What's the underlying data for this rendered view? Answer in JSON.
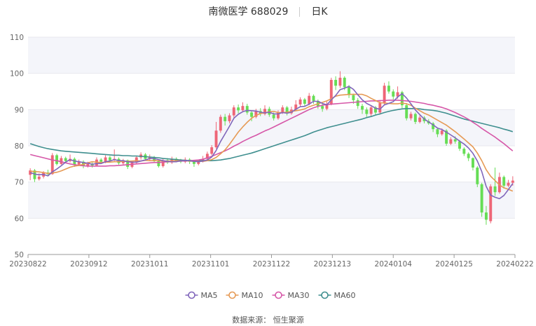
{
  "title": {
    "stock": "南微医学 688029",
    "period": "日K"
  },
  "source_text": "数据来源：  恒生聚源",
  "colors": {
    "up": "#ee6677",
    "down": "#66dd55",
    "ma5": "#8066bb",
    "ma10": "#e69a55",
    "ma30": "#d657a8",
    "ma60": "#3f8f8f",
    "band": "#f4f5fa",
    "grid": "#e8e8ee"
  },
  "chart_data": {
    "type": "candlestick",
    "ylim": [
      50,
      110
    ],
    "yticks": [
      50,
      60,
      70,
      80,
      90,
      100,
      110
    ],
    "xtick_labels": [
      "20230822",
      "20230912",
      "20231011",
      "20231101",
      "20231122",
      "20231213",
      "20240104",
      "20240125",
      "20240222"
    ],
    "legend": [
      "MA5",
      "MA10",
      "MA30",
      "MA60"
    ],
    "legend_position": "bottom",
    "candles": [
      [
        72.0,
        73.2,
        73.8,
        70.5
      ],
      [
        73.2,
        70.8,
        73.6,
        70.0
      ],
      [
        70.8,
        71.5,
        72.4,
        70.4
      ],
      [
        71.5,
        72.6,
        73.0,
        71.0
      ],
      [
        72.6,
        72.2,
        73.4,
        71.6
      ],
      [
        72.2,
        77.4,
        78.0,
        72.0
      ],
      [
        77.4,
        75.0,
        77.8,
        74.6
      ],
      [
        75.0,
        76.6,
        77.2,
        74.8
      ],
      [
        76.6,
        75.8,
        77.0,
        75.2
      ],
      [
        75.8,
        76.4,
        77.6,
        75.4
      ],
      [
        76.4,
        74.8,
        76.8,
        74.2
      ],
      [
        74.8,
        75.6,
        76.2,
        74.4
      ],
      [
        75.6,
        74.4,
        76.0,
        73.8
      ],
      [
        74.4,
        75.0,
        75.6,
        74.0
      ],
      [
        75.0,
        74.6,
        75.4,
        74.0
      ],
      [
        74.6,
        76.2,
        76.8,
        74.4
      ],
      [
        76.2,
        75.6,
        76.6,
        75.0
      ],
      [
        75.6,
        76.8,
        77.4,
        75.2
      ],
      [
        76.8,
        76.0,
        77.2,
        75.6
      ],
      [
        76.0,
        76.4,
        79.0,
        75.8
      ],
      [
        76.4,
        75.2,
        76.8,
        74.8
      ],
      [
        75.2,
        76.0,
        76.4,
        74.6
      ],
      [
        76.0,
        74.2,
        76.2,
        73.6
      ],
      [
        74.2,
        75.4,
        75.8,
        73.8
      ],
      [
        75.4,
        76.8,
        77.2,
        75.0
      ],
      [
        76.8,
        77.6,
        78.2,
        76.2
      ],
      [
        77.6,
        76.4,
        78.0,
        76.0
      ],
      [
        76.4,
        76.8,
        77.6,
        75.8
      ],
      [
        76.8,
        75.8,
        77.2,
        75.4
      ],
      [
        75.8,
        74.4,
        76.2,
        74.0
      ],
      [
        74.4,
        76.0,
        76.6,
        74.0
      ],
      [
        76.0,
        75.4,
        76.6,
        75.0
      ],
      [
        75.4,
        76.4,
        77.0,
        75.0
      ],
      [
        76.4,
        76.0,
        76.8,
        75.6
      ],
      [
        76.0,
        75.6,
        76.4,
        75.2
      ],
      [
        75.6,
        76.2,
        76.8,
        75.2
      ],
      [
        76.2,
        75.6,
        76.6,
        75.0
      ],
      [
        75.6,
        75.0,
        76.0,
        74.2
      ],
      [
        75.0,
        75.8,
        76.2,
        74.6
      ],
      [
        75.8,
        76.4,
        77.2,
        75.4
      ],
      [
        76.4,
        77.8,
        78.4,
        76.0
      ],
      [
        77.8,
        79.6,
        80.2,
        77.4
      ],
      [
        79.6,
        84.2,
        86.6,
        79.2
      ],
      [
        84.2,
        88.0,
        88.6,
        83.6
      ],
      [
        88.0,
        86.8,
        88.8,
        85.6
      ],
      [
        86.8,
        88.4,
        89.0,
        86.2
      ],
      [
        88.4,
        90.6,
        91.2,
        87.8
      ],
      [
        90.6,
        89.8,
        91.4,
        89.0
      ],
      [
        89.8,
        91.0,
        92.0,
        89.4
      ],
      [
        91.0,
        89.2,
        91.6,
        88.6
      ],
      [
        89.2,
        88.0,
        89.6,
        86.8
      ],
      [
        88.0,
        89.6,
        90.2,
        87.6
      ],
      [
        89.6,
        88.8,
        90.4,
        88.2
      ],
      [
        88.8,
        90.2,
        91.2,
        88.4
      ],
      [
        90.2,
        88.6,
        90.8,
        88.0
      ],
      [
        88.6,
        87.6,
        89.2,
        87.0
      ],
      [
        87.6,
        89.2,
        89.8,
        87.2
      ],
      [
        89.2,
        90.6,
        91.2,
        88.8
      ],
      [
        90.6,
        89.0,
        91.0,
        88.4
      ],
      [
        89.0,
        90.0,
        90.8,
        88.6
      ],
      [
        90.0,
        91.4,
        92.6,
        89.6
      ],
      [
        91.4,
        92.8,
        93.4,
        90.8
      ],
      [
        92.8,
        91.6,
        93.2,
        91.0
      ],
      [
        91.6,
        93.8,
        94.6,
        91.2
      ],
      [
        93.8,
        92.4,
        94.2,
        91.6
      ],
      [
        92.4,
        91.0,
        92.8,
        90.2
      ],
      [
        91.0,
        90.2,
        91.6,
        89.4
      ],
      [
        90.2,
        91.6,
        92.2,
        89.8
      ],
      [
        91.6,
        98.2,
        98.8,
        91.2
      ],
      [
        98.2,
        96.6,
        99.2,
        95.4
      ],
      [
        96.6,
        98.8,
        100.6,
        96.0
      ],
      [
        98.8,
        96.2,
        99.2,
        95.4
      ],
      [
        96.2,
        94.0,
        96.8,
        93.2
      ],
      [
        94.0,
        92.6,
        94.4,
        91.6
      ],
      [
        92.6,
        91.0,
        93.2,
        90.2
      ],
      [
        91.0,
        90.0,
        91.6,
        88.8
      ],
      [
        90.0,
        88.8,
        90.6,
        88.0
      ],
      [
        88.8,
        90.6,
        91.2,
        88.2
      ],
      [
        90.6,
        89.2,
        91.0,
        88.4
      ],
      [
        89.2,
        91.8,
        92.4,
        88.6
      ],
      [
        91.8,
        96.6,
        97.4,
        91.4
      ],
      [
        96.6,
        95.0,
        97.8,
        94.4
      ],
      [
        95.0,
        93.6,
        95.6,
        92.8
      ],
      [
        93.6,
        94.8,
        96.4,
        93.0
      ],
      [
        94.8,
        91.2,
        95.2,
        90.4
      ],
      [
        91.2,
        87.6,
        91.8,
        87.0
      ],
      [
        87.6,
        88.8,
        89.4,
        87.0
      ],
      [
        88.8,
        86.6,
        89.2,
        86.0
      ],
      [
        86.6,
        87.8,
        88.4,
        86.2
      ],
      [
        87.8,
        86.8,
        88.2,
        86.2
      ],
      [
        86.8,
        86.2,
        87.4,
        85.8
      ],
      [
        86.2,
        84.6,
        86.6,
        83.8
      ],
      [
        84.6,
        83.2,
        85.0,
        82.4
      ],
      [
        83.2,
        84.2,
        84.8,
        82.8
      ],
      [
        84.2,
        80.6,
        84.6,
        80.0
      ],
      [
        80.6,
        81.8,
        82.4,
        80.2
      ],
      [
        81.8,
        81.2,
        82.6,
        80.6
      ],
      [
        81.2,
        79.2,
        81.6,
        78.6
      ],
      [
        79.2,
        77.8,
        79.6,
        77.2
      ],
      [
        77.8,
        76.6,
        78.2,
        75.8
      ],
      [
        76.6,
        74.0,
        76.8,
        73.2
      ],
      [
        74.0,
        69.4,
        74.4,
        68.6
      ],
      [
        69.4,
        61.6,
        69.8,
        60.4
      ],
      [
        61.6,
        59.6,
        63.4,
        58.2
      ],
      [
        59.2,
        68.8,
        69.4,
        58.6
      ],
      [
        68.8,
        67.2,
        74.0,
        66.2
      ],
      [
        67.2,
        71.4,
        72.6,
        66.8
      ],
      [
        71.4,
        69.0,
        71.8,
        68.2
      ],
      [
        69.0,
        69.8,
        70.6,
        68.6
      ],
      [
        69.8,
        70.4,
        71.6,
        69.0
      ]
    ],
    "ma5": [
      72.6,
      72.2,
      72.0,
      72.1,
      71.7,
      72.8,
      73.6,
      74.5,
      75.5,
      76.2,
      75.8,
      75.6,
      75.4,
      75.2,
      74.9,
      75.1,
      75.1,
      75.6,
      75.8,
      76.2,
      75.9,
      75.9,
      75.6,
      75.5,
      75.5,
      75.8,
      76.1,
      76.5,
      76.5,
      76.2,
      75.9,
      75.7,
      75.6,
      75.6,
      75.9,
      75.9,
      75.9,
      75.7,
      75.6,
      75.8,
      76.1,
      76.9,
      78.7,
      81.2,
      83.3,
      85.4,
      87.6,
      88.7,
      89.4,
      89.8,
      89.7,
      89.6,
      89.3,
      89.1,
      89.3,
      88.8,
      88.8,
      89.2,
      89.0,
      89.3,
      90.1,
      90.8,
      90.9,
      91.5,
      92.3,
      92.3,
      91.7,
      91.3,
      92.7,
      93.9,
      95.5,
      95.9,
      96.4,
      95.6,
      94.1,
      92.7,
      91.7,
      91.1,
      90.4,
      90.1,
      91.3,
      91.7,
      92.2,
      93.5,
      94.4,
      93.2,
      91.6,
      89.9,
      88.6,
      87.4,
      86.6,
      85.8,
      84.9,
      84.5,
      83.8,
      83.0,
      82.2,
      81.3,
      80.5,
      79.4,
      77.9,
      75.8,
      72.9,
      68.8,
      66.4,
      65.8,
      65.4,
      66.3,
      67.9,
      69.6
    ],
    "ma10": [
      73.0,
      72.9,
      72.8,
      72.6,
      72.4,
      72.5,
      72.7,
      73.1,
      73.6,
      74.1,
      74.4,
      74.6,
      74.9,
      75.3,
      75.6,
      75.5,
      75.4,
      75.5,
      75.5,
      75.6,
      75.6,
      75.7,
      75.7,
      75.8,
      75.9,
      75.8,
      76.0,
      75.9,
      75.9,
      75.9,
      75.8,
      75.8,
      75.8,
      75.9,
      75.9,
      75.9,
      75.8,
      75.7,
      75.7,
      75.7,
      75.9,
      76.2,
      76.8,
      77.8,
      78.9,
      80.4,
      82.1,
      83.8,
      85.2,
      86.5,
      87.6,
      88.4,
      88.9,
      89.1,
      89.4,
      89.5,
      89.2,
      89.2,
      89.3,
      89.5,
      89.7,
      89.9,
      90.2,
      90.8,
      91.2,
      91.6,
      92.0,
      92.4,
      93.0,
      93.7,
      94.0,
      94.1,
      94.2,
      94.2,
      94.2,
      94.2,
      93.8,
      93.1,
      92.5,
      91.9,
      91.8,
      91.7,
      91.6,
      91.6,
      91.8,
      91.6,
      91.2,
      90.4,
      89.7,
      89.0,
      88.5,
      87.8,
      87.1,
      86.4,
      85.7,
      84.8,
      83.9,
      82.9,
      81.9,
      80.8,
      79.7,
      78.0,
      75.9,
      73.4,
      71.6,
      70.4,
      69.2,
      68.4,
      68.0,
      67.5
    ],
    "ma30": [
      77.6,
      77.3,
      77.0,
      76.7,
      76.4,
      76.1,
      75.9,
      75.6,
      75.3,
      75.0,
      74.8,
      74.6,
      74.5,
      74.4,
      74.4,
      74.4,
      74.4,
      74.4,
      74.5,
      74.5,
      74.6,
      74.7,
      74.8,
      74.9,
      75.0,
      75.1,
      75.2,
      75.3,
      75.4,
      75.4,
      75.5,
      75.6,
      75.6,
      75.7,
      75.8,
      75.8,
      75.9,
      76.0,
      76.1,
      76.3,
      76.7,
      77.1,
      77.6,
      78.1,
      78.6,
      79.2,
      79.9,
      80.5,
      81.2,
      81.8,
      82.4,
      82.9,
      83.5,
      84.1,
      84.6,
      85.2,
      85.8,
      86.4,
      87.0,
      87.6,
      88.2,
      88.8,
      89.4,
      90.0,
      90.5,
      90.9,
      91.2,
      91.4,
      91.5,
      91.6,
      91.7,
      91.8,
      91.9,
      92.0,
      92.1,
      92.2,
      92.3,
      92.4,
      92.4,
      92.5,
      92.5,
      92.6,
      92.6,
      92.6,
      92.5,
      92.4,
      92.3,
      92.1,
      91.9,
      91.7,
      91.4,
      91.2,
      90.9,
      90.6,
      90.2,
      89.7,
      89.2,
      88.6,
      88.0,
      87.3,
      86.5,
      85.7,
      84.8,
      84.0,
      83.2,
      82.4,
      81.5,
      80.6,
      79.6,
      78.6
    ],
    "ma60": [
      80.6,
      80.2,
      79.8,
      79.5,
      79.2,
      79.0,
      78.8,
      78.6,
      78.5,
      78.4,
      78.3,
      78.2,
      78.1,
      78.0,
      77.9,
      77.8,
      77.7,
      77.6,
      77.5,
      77.4,
      77.4,
      77.3,
      77.3,
      77.2,
      77.2,
      77.1,
      77.0,
      76.9,
      76.8,
      76.7,
      76.5,
      76.4,
      76.3,
      76.2,
      76.1,
      76.0,
      75.9,
      75.9,
      75.9,
      75.9,
      75.9,
      75.9,
      76.0,
      76.1,
      76.3,
      76.5,
      76.8,
      77.1,
      77.4,
      77.7,
      78.0,
      78.4,
      78.8,
      79.2,
      79.6,
      80.0,
      80.4,
      80.8,
      81.2,
      81.6,
      82.0,
      82.4,
      82.8,
      83.3,
      83.8,
      84.2,
      84.6,
      85.0,
      85.3,
      85.6,
      85.9,
      86.2,
      86.5,
      86.8,
      87.1,
      87.4,
      87.8,
      88.1,
      88.5,
      88.8,
      89.2,
      89.5,
      89.8,
      90.0,
      90.2,
      90.3,
      90.3,
      90.3,
      90.2,
      90.0,
      89.9,
      89.8,
      89.6,
      89.3,
      89.0,
      88.6,
      88.2,
      87.8,
      87.4,
      87.1,
      86.8,
      86.5,
      86.2,
      85.9,
      85.6,
      85.3,
      85.0,
      84.6,
      84.3,
      83.9
    ]
  }
}
